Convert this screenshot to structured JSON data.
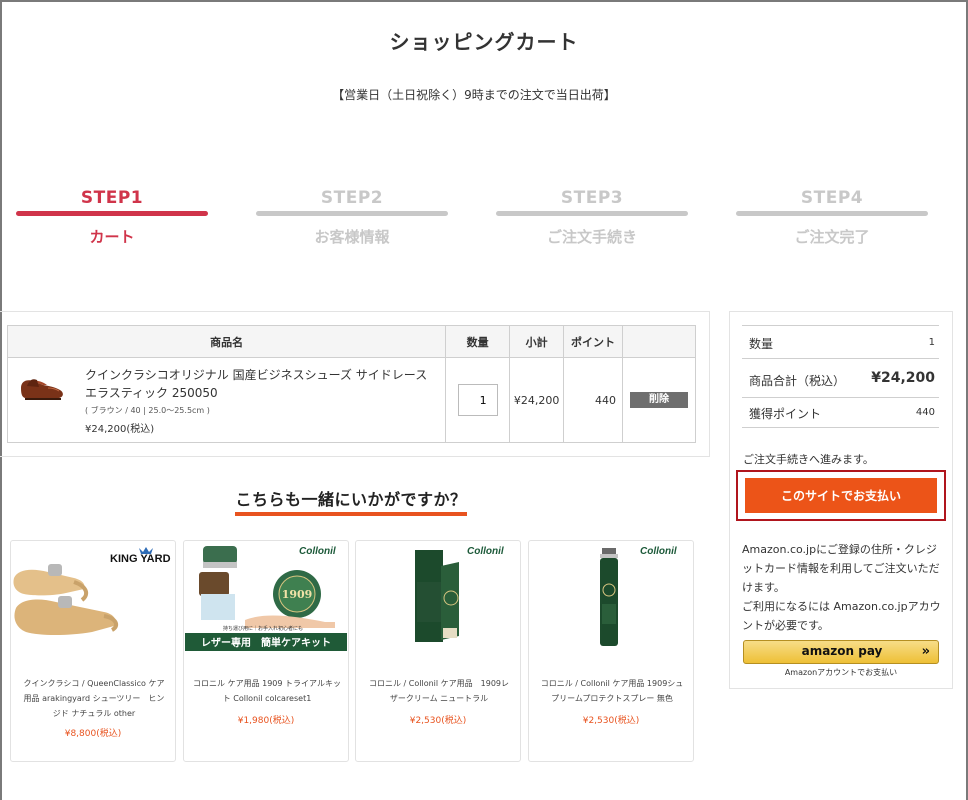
{
  "page": {
    "title": "ショッピングカート",
    "notice": "【営業日（土日祝除く）9時までの注文で当日出荷】"
  },
  "steps": [
    {
      "num": "STEP1",
      "label": "カート",
      "active": true
    },
    {
      "num": "STEP2",
      "label": "お客様情報",
      "active": false
    },
    {
      "num": "STEP3",
      "label": "ご注文手続き",
      "active": false
    },
    {
      "num": "STEP4",
      "label": "ご注文完了",
      "active": false
    }
  ],
  "cart": {
    "headers": {
      "product": "商品名",
      "qty": "数量",
      "subtotal": "小計",
      "points": "ポイント",
      "action": ""
    },
    "items": [
      {
        "name": "クインクラシコオリジナル 国産ビジネスシューズ サイドレース エラスティック 250050",
        "variant": "( ブラウン / 40 | 25.0～25.5cm )",
        "price": "¥24,200(税込)",
        "qty": "1",
        "subtotal": "¥24,200",
        "points": "440",
        "delete_label": "削除",
        "image": "brown-leather-shoe"
      }
    ]
  },
  "recommend": {
    "title": "こちらも一緒にいかがですか？",
    "items": [
      {
        "name": "クインクラシコ / QueenClassico ケア用品 arakingyard シューツリー　ヒンジド ナチュラル other",
        "price": "¥8,800(税込)",
        "brand": "KING YARD",
        "image": "wooden-shoe-tree"
      },
      {
        "name": "コロニル ケア用品 1909 トライアルキット Collonil colcareset1",
        "price": "¥1,980(税込)",
        "brand": "Collonil",
        "banner": "レザー専用　簡単ケアキット",
        "sub_banner": "持ち運び用に｜お手入れ初心者にも",
        "tin_label": "1909",
        "image": "collonil-care-kit"
      },
      {
        "name": "コロニル / Collonil ケア用品　1909レザークリーム ニュートラル",
        "price": "¥2,530(税込)",
        "brand": "Collonil",
        "image": "collonil-leather-cream"
      },
      {
        "name": "コロニル / Collonil ケア用品 1909シュプリームプロテクトスプレー 無色",
        "price": "¥2,530(税込)",
        "brand": "Collonil",
        "image": "collonil-protect-spray"
      }
    ]
  },
  "summary": {
    "rows": [
      {
        "label": "数量",
        "value": "1"
      },
      {
        "label": "商品合計（税込）",
        "value": "¥24,200"
      },
      {
        "label": "獲得ポイント",
        "value": "440"
      }
    ],
    "proceed_text": "ご注文手続きへ進みます。",
    "pay_button": "このサイトでお支払い",
    "amazon_text_1": "Amazon.co.jpにご登録の住所・クレジットカード情報を利用してご注文いただけます。",
    "amazon_text_2": "ご利用になるには Amazon.co.jpアカウントが必要です。",
    "amazon_button": "amazon pay",
    "amazon_caption": "Amazonアカウントでお支払い"
  },
  "colors": {
    "accent_step": "#d0344a",
    "pay_button": "#ec5418",
    "price": "#e8531f",
    "pay_frame": "#b0151d"
  }
}
